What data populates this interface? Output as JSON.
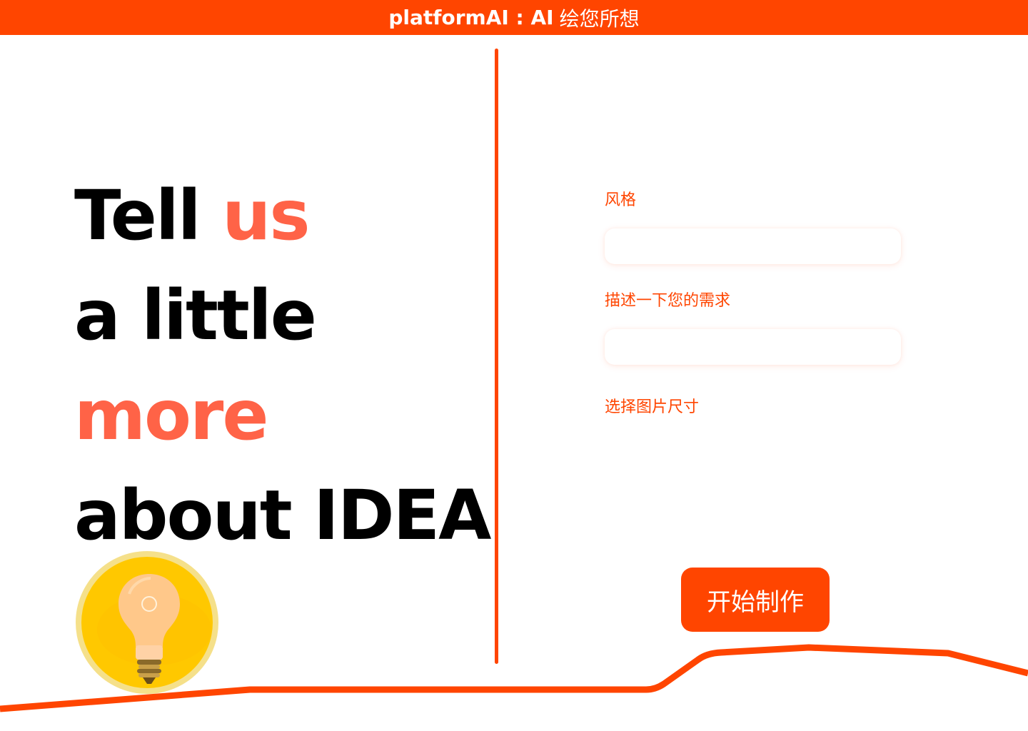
{
  "header": {
    "brand": "platformAI : AI",
    "tagline": "绘您所想"
  },
  "hero": {
    "line1_a": "Tell ",
    "line1_b": "us",
    "line2": "a little",
    "line3": "more",
    "line4": "about IDEA"
  },
  "form": {
    "style_label": "风格",
    "style_value": "",
    "description_label": "描述一下您的需求",
    "description_value": "",
    "size_label": "选择图片尺寸",
    "submit_label": "开始制作"
  },
  "colors": {
    "accent": "#ff4500",
    "highlight": "#ff6347",
    "bulb_background": "#ffc800"
  },
  "icons": {
    "bulb": "lightbulb-icon"
  }
}
